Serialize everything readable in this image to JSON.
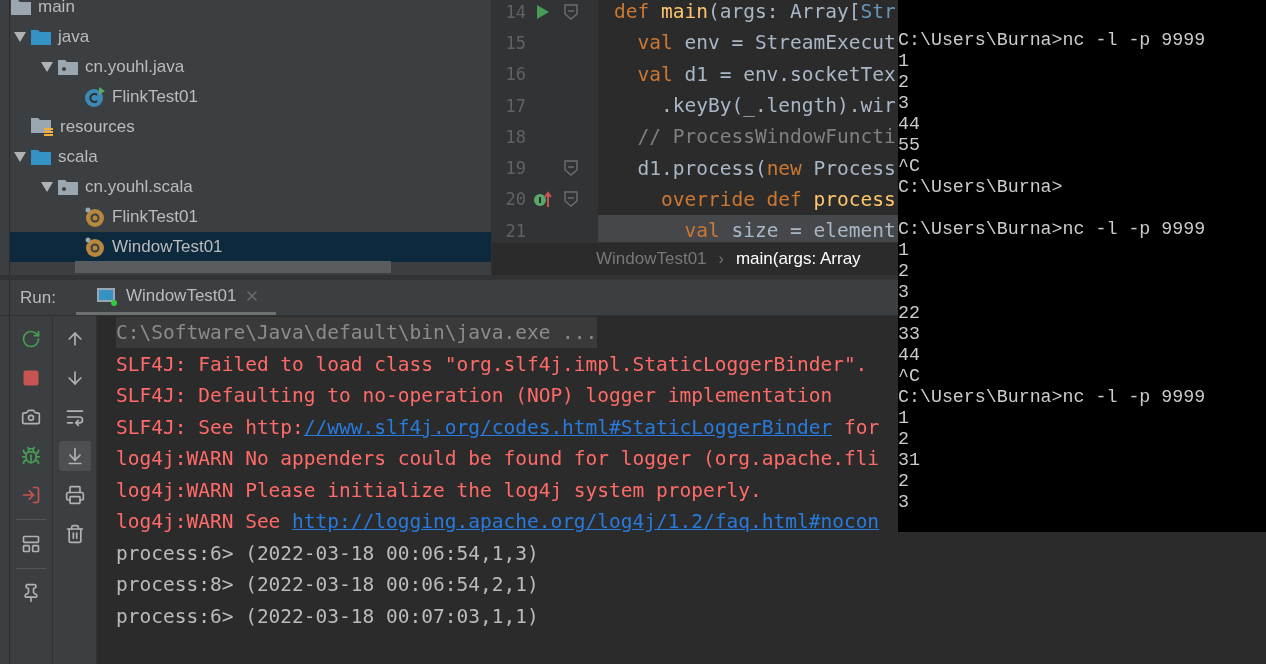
{
  "project": {
    "tree": [
      {
        "label": "main",
        "kind": "folder",
        "selected": false,
        "children": [
          {
            "label": "java",
            "kind": "source-folder",
            "expanded": true,
            "selected": false,
            "children": [
              {
                "label": "cn.youhl.java",
                "kind": "package",
                "expanded": true,
                "selected": false,
                "children": [
                  {
                    "label": "FlinkTest01",
                    "kind": "java-class",
                    "selected": false
                  }
                ]
              }
            ]
          },
          {
            "label": "resources",
            "kind": "resources",
            "selected": false
          },
          {
            "label": "scala",
            "kind": "source-folder",
            "expanded": true,
            "selected": false,
            "children": [
              {
                "label": "cn.youhl.scala",
                "kind": "package",
                "expanded": true,
                "selected": false,
                "children": [
                  {
                    "label": "FlinkTest01",
                    "kind": "scala-object",
                    "selected": false
                  },
                  {
                    "label": "WindowTest01",
                    "kind": "scala-object",
                    "selected": true
                  }
                ]
              }
            ]
          }
        ]
      }
    ]
  },
  "editor": {
    "lines": [
      {
        "number": "14",
        "kind": "run",
        "foldable": true,
        "current": false,
        "tokens": [
          {
            "text": "def ",
            "kind": "keyword"
          },
          {
            "text": "main",
            "kind": "function"
          },
          {
            "text": "(args: Array[",
            "kind": "plain"
          },
          {
            "text": "Str",
            "kind": "type"
          }
        ]
      },
      {
        "number": "15",
        "foldable": false,
        "current": false,
        "tokens": [
          {
            "text": "  val",
            "kind": "keyword"
          },
          {
            "text": " env = StreamExecut",
            "kind": "plain"
          }
        ]
      },
      {
        "number": "16",
        "foldable": false,
        "current": false,
        "tokens": [
          {
            "text": "  val",
            "kind": "keyword"
          },
          {
            "text": " d1 = env.socketTex",
            "kind": "plain"
          }
        ]
      },
      {
        "number": "17",
        "foldable": false,
        "current": false,
        "tokens": [
          {
            "text": "    .keyBy(_.length).wir",
            "kind": "plain"
          }
        ]
      },
      {
        "number": "18",
        "foldable": false,
        "current": false,
        "tokens": [
          {
            "text": "  // ProcessWindowFuncti",
            "kind": "comment"
          }
        ]
      },
      {
        "number": "19",
        "foldable": true,
        "current": false,
        "tokens": [
          {
            "text": "  d1.process(",
            "kind": "plain"
          },
          {
            "text": "new",
            "kind": "keyword"
          },
          {
            "text": " Process",
            "kind": "plain"
          }
        ]
      },
      {
        "number": "20",
        "kind": "override",
        "foldable": true,
        "current": false,
        "tokens": [
          {
            "text": "    override def ",
            "kind": "keyword"
          },
          {
            "text": "process",
            "kind": "function"
          }
        ]
      },
      {
        "number": "21",
        "foldable": false,
        "current": true,
        "tokens": [
          {
            "text": "      val",
            "kind": "keyword"
          },
          {
            "text": " size = element",
            "kind": "plain"
          }
        ]
      }
    ],
    "breadcrumb": [
      {
        "label": "WindowTest01",
        "selected": false
      },
      {
        "label": "main(args: Array",
        "selected": true
      }
    ],
    "breadcrumb_separator": "›"
  },
  "run": {
    "label": "Run:",
    "tab": {
      "title": "WindowTest01",
      "selected": true,
      "running": true
    },
    "scroll_to_end": {
      "on": true
    },
    "console": [
      {
        "kind": "command",
        "parts": [
          {
            "text": "C:\\Software\\Java\\default\\bin\\java.exe ...",
            "link": false
          }
        ]
      },
      {
        "kind": "error",
        "parts": [
          {
            "text": "SLF4J: Failed to load class \"org.slf4j.impl.StaticLoggerBinder\".",
            "link": false
          }
        ]
      },
      {
        "kind": "error",
        "parts": [
          {
            "text": "SLF4J: Defaulting to no-operation (NOP) logger implementation",
            "link": false
          }
        ]
      },
      {
        "kind": "error",
        "parts": [
          {
            "text": "SLF4J: See http:",
            "link": false
          },
          {
            "text": "//www.slf4j.org/codes.html#StaticLoggerBinder",
            "link": true
          },
          {
            "text": " for",
            "link": false
          }
        ]
      },
      {
        "kind": "error",
        "parts": [
          {
            "text": "log4j:WARN No appenders could be found for logger (org.apache.fli",
            "link": false
          }
        ]
      },
      {
        "kind": "error",
        "parts": [
          {
            "text": "log4j:WARN Please initialize the log4j system properly.",
            "link": false
          }
        ]
      },
      {
        "kind": "error",
        "parts": [
          {
            "text": "log4j:WARN See ",
            "link": false
          },
          {
            "text": "http://logging.apache.org/log4j/1.2/faq.html#nocon",
            "link": true
          }
        ]
      },
      {
        "kind": "output",
        "parts": [
          {
            "text": "process:6> (2022-03-18 00:06:54,1,3)",
            "link": false
          }
        ]
      },
      {
        "kind": "output",
        "parts": [
          {
            "text": "process:8> (2022-03-18 00:06:54,2,1)",
            "link": false
          }
        ]
      },
      {
        "kind": "output",
        "parts": [
          {
            "text": "process:6> (2022-03-18 00:07:03,1,1)",
            "link": false
          }
        ]
      }
    ]
  },
  "terminal": {
    "lines": [
      {
        "text": "C:\\Users\\Burna>nc -l -p 9999",
        "blank_before": true
      },
      {
        "text": "1",
        "blank_before": false
      },
      {
        "text": "2",
        "blank_before": false
      },
      {
        "text": "3",
        "blank_before": false
      },
      {
        "text": "44",
        "blank_before": false
      },
      {
        "text": "55",
        "blank_before": false
      },
      {
        "text": "^C",
        "blank_before": false
      },
      {
        "text": "C:\\Users\\Burna>",
        "blank_before": false
      },
      {
        "text": "C:\\Users\\Burna>nc -l -p 9999",
        "blank_before": true
      },
      {
        "text": "1",
        "blank_before": false
      },
      {
        "text": "2",
        "blank_before": false
      },
      {
        "text": "3",
        "blank_before": false
      },
      {
        "text": "22",
        "blank_before": false
      },
      {
        "text": "33",
        "blank_before": false
      },
      {
        "text": "44",
        "blank_before": false
      },
      {
        "text": "^C",
        "blank_before": false
      },
      {
        "text": "C:\\Users\\Burna>nc -l -p 9999",
        "blank_before": false
      },
      {
        "text": "1",
        "blank_before": false
      },
      {
        "text": "2",
        "blank_before": false
      },
      {
        "text": "31",
        "blank_before": false
      },
      {
        "text": "2",
        "blank_before": false
      },
      {
        "text": "3",
        "blank_before": false
      }
    ]
  }
}
